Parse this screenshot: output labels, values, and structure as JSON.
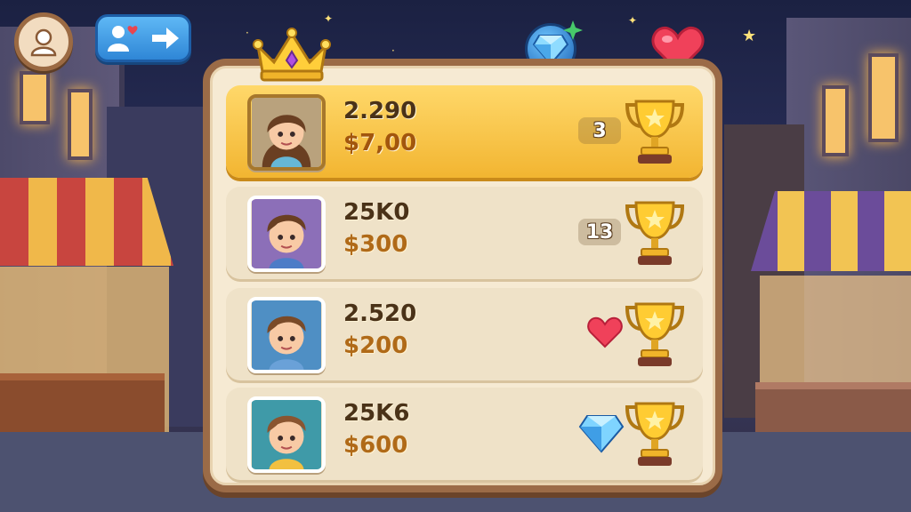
{
  "hud": {
    "profile_icon": "profile-icon",
    "friends_icons": [
      "add-friend-icon",
      "arrow-right-icon"
    ],
    "gem_icon": "gem-icon",
    "heart_icon": "heart-icon"
  },
  "leaderboard": {
    "header_icon": "crown-icon",
    "rows": [
      {
        "score": "2.290",
        "money": "$7,00",
        "rank": "3",
        "indicator": "rank",
        "avatar": "girl-avatar",
        "highlight": true
      },
      {
        "score": "25K0",
        "money": "$300",
        "rank": "13",
        "indicator": "rank",
        "avatar": "boy-avatar-purple"
      },
      {
        "score": "2.520",
        "money": "$200",
        "indicator": "heart",
        "avatar": "boy-avatar-blue"
      },
      {
        "score": "25K6",
        "money": "$600",
        "indicator": "gem",
        "avatar": "boy-avatar-teal"
      }
    ]
  },
  "colors": {
    "highlight": "#f2b531",
    "panel": "#f6ead3",
    "frame": "#9b6b47",
    "money": "#b06a18"
  }
}
